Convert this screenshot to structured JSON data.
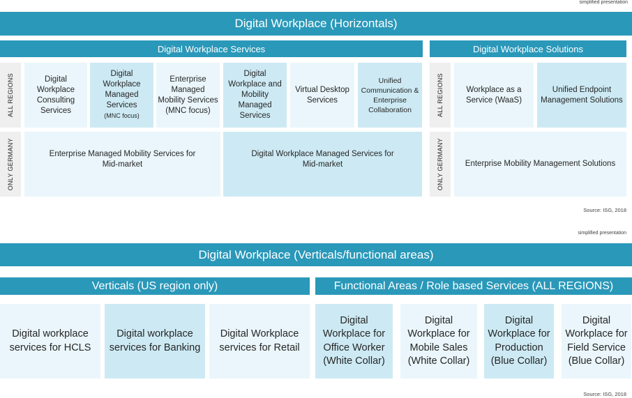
{
  "top": {
    "note": "simplified presentation",
    "title": "Digital Workplace (Horizontals)",
    "services_header": "Digital Workplace Services",
    "solutions_header": "Digital Workplace Solutions",
    "region_all": "ALL REGIONS",
    "region_germany": "ONLY GERMANY",
    "services_all_regions": [
      {
        "text": "Digital Workplace Consulting Services",
        "sub": ""
      },
      {
        "text": "Digital Workplace Managed Services",
        "sub": "(MNC focus)"
      },
      {
        "text": "Enterprise Managed Mobility Services (MNC focus)",
        "sub": ""
      },
      {
        "text": "Digital Workplace and Mobility Managed Services",
        "sub": ""
      },
      {
        "text": "Virtual Desktop Services",
        "sub": ""
      },
      {
        "text": "Unified Communication & Enterprise Collaboration",
        "sub": ""
      }
    ],
    "services_germany": [
      "Enterprise Managed Mobility Services for Mid-market",
      "Digital Workplace Managed Services for Mid-market"
    ],
    "solutions_all_regions": [
      "Workplace as a Service (WaaS)",
      "Unified Endpoint Management Solutions"
    ],
    "solutions_germany": "Enterprise Mobility Management Solutions",
    "source": "Source: ISG, 2018"
  },
  "bottom": {
    "note": "simplified presentation",
    "title": "Digital Workplace (Verticals/functional areas)",
    "verticals_header": "Verticals (US region only)",
    "functional_header": "Functional Areas / Role based Services (ALL REGIONS)",
    "verticals": [
      "Digital workplace services for HCLS",
      "Digital workplace services for Banking",
      "Digital Workplace services for Retail"
    ],
    "functional": [
      "Digital Workplace for Office Worker (White Collar)",
      "Digital Workplace for Mobile Sales (White Collar)",
      "Digital Workplace for Production (Blue Collar)",
      "Digital Workplace for Field Service (Blue Collar)"
    ],
    "source": "Source: ISG, 2018"
  },
  "colors": {
    "header_blue": "#2a98b9",
    "cell_light": "#eaf6fb",
    "cell_mid": "#cdeaf4",
    "region_gray": "#efefef"
  }
}
